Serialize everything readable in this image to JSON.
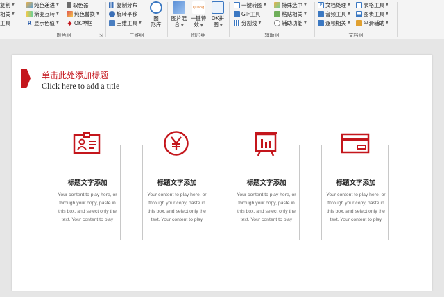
{
  "ribbon": {
    "col0": {
      "r1": "复制",
      "r2": "相关",
      "r3": "工具"
    },
    "color_group": {
      "label": "颜色组",
      "r1a": "纯色递进",
      "r1b": "取色器",
      "r2a": "渐变互转",
      "r2b": "纯色替换",
      "r3a": "显示色值",
      "r3b": "OK神框"
    },
    "three_d_group": {
      "label": "三维组",
      "r1": "复制分布",
      "r2": "旋转平移",
      "r3": "三维工具",
      "big_label_1": "图",
      "big_label_2": "形库"
    },
    "shape_group": {
      "label": "图形组",
      "b1_l1": "图片混",
      "b1_l2": "合",
      "b2_l1": "一键特",
      "b2_l2": "效",
      "b3_l1": "OK拼",
      "b3_l2": "图",
      "b2_badge": "Quang"
    },
    "aux_group": {
      "label": "辅助组",
      "r1a": "一键转图",
      "r1b": "特殊选中",
      "r2a": "GIF工具",
      "r2b": "粘贴相关",
      "r3a": "分割线",
      "r3b": "辅助功能"
    },
    "doc_group": {
      "label": "文档组",
      "r1a": "文档处理",
      "r1b": "表格工具",
      "r2a": "音频工具",
      "r2b": "图表工具",
      "r3a": "逐帧相关",
      "r3b": "平滑辅助"
    }
  },
  "slide": {
    "title_cn": "单击此处添加标题",
    "title_en": "Click here to add a title",
    "cards": [
      {
        "icon": "id-card-icon",
        "title": "标题文字添加",
        "body": "Your content to play here, or through your copy, paste in this box, and select only the text. Your content to play"
      },
      {
        "icon": "yen-coin-icon",
        "title": "标题文字添加",
        "body": "Your content to play here, or through your copy, paste in this box, and select only the text. Your content to play"
      },
      {
        "icon": "presentation-board-icon",
        "title": "标题文字添加",
        "body": "Your content to play here, or through your copy, paste in this box, and select only the text. Your content to play"
      },
      {
        "icon": "credit-card-icon",
        "title": "标题文字添加",
        "body": "Your content to play here, or through your copy, paste in this box, and select only the text. Your content to play"
      }
    ]
  },
  "colors": {
    "accent": "#c4161c",
    "slide_bg": "#ffffff",
    "workspace_bg": "#e6e6e6",
    "ribbon_bg": "#f4f4f4"
  }
}
